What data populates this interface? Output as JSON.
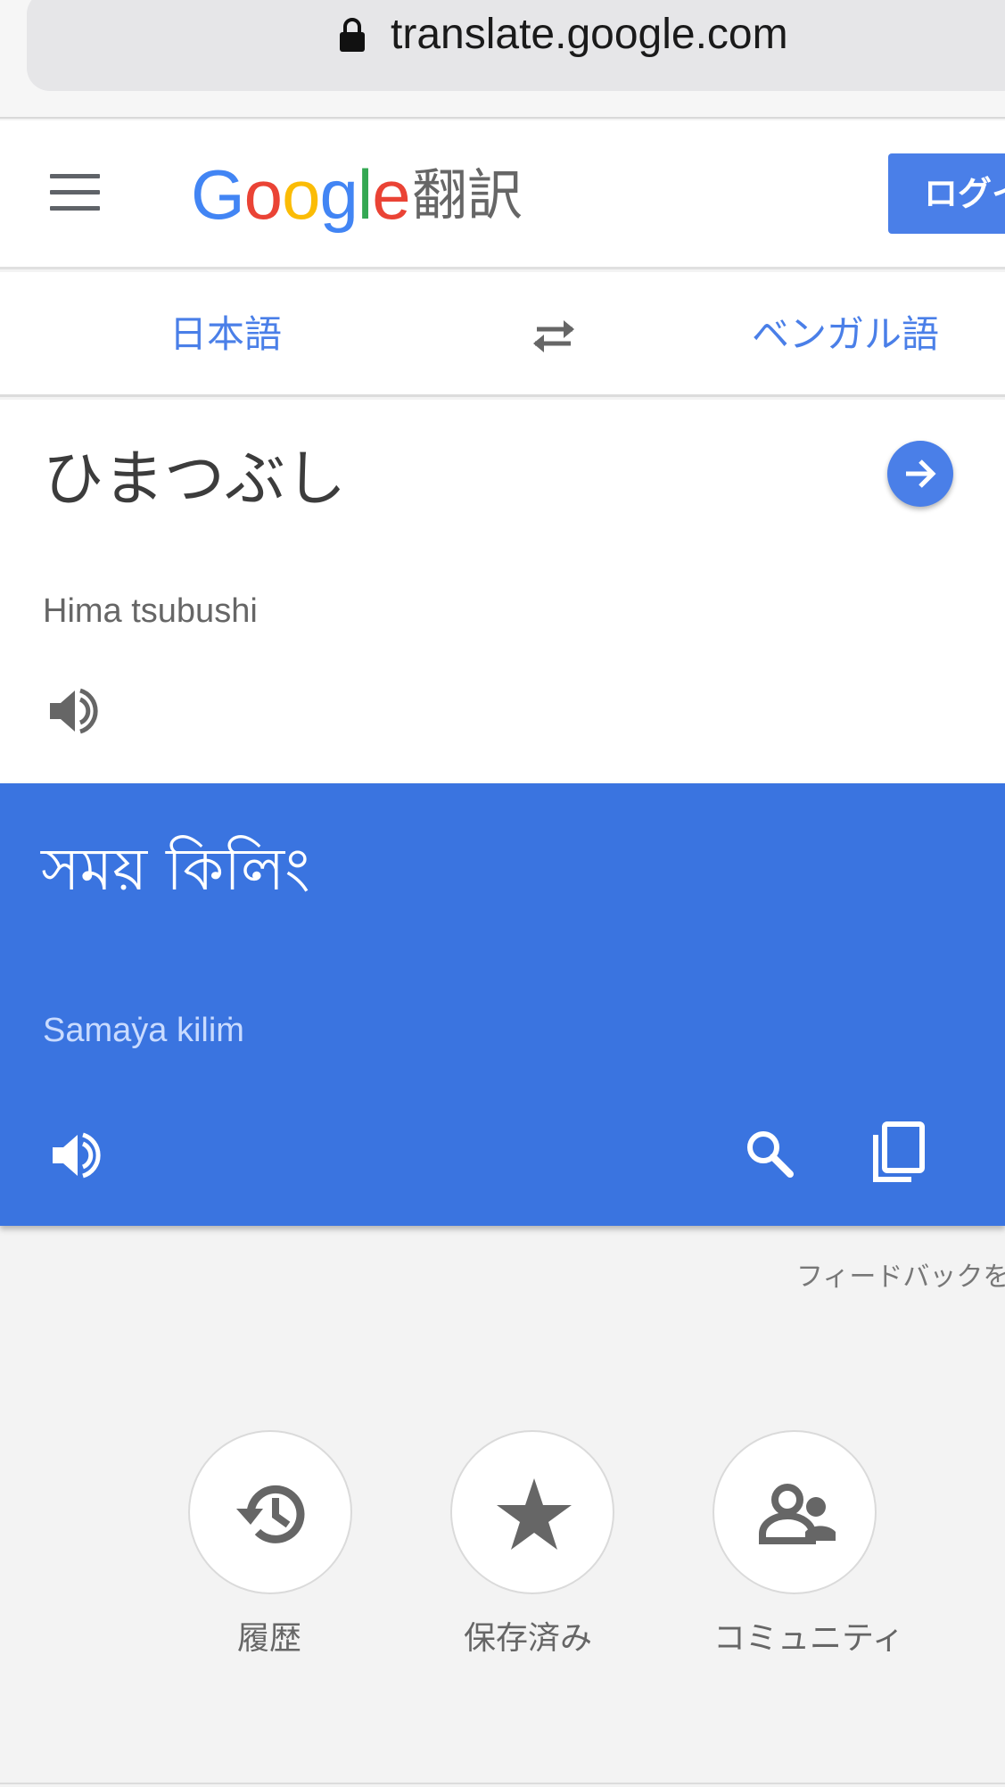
{
  "browser": {
    "url": "translate.google.com",
    "lock_icon": "lock-icon"
  },
  "header": {
    "menu_icon": "hamburger-menu-icon",
    "logo_letters": [
      "G",
      "o",
      "o",
      "g",
      "l",
      "e"
    ],
    "product_name": "翻訳",
    "login_label": "ログイ"
  },
  "languages": {
    "source": "日本語",
    "target": "ベンガル語",
    "swap_icon": "swap-arrows-icon"
  },
  "source": {
    "text": "ひまつぶし",
    "transliteration": "Hima tsubushi",
    "go_icon": "arrow-right-icon",
    "speaker_icon": "speaker-icon"
  },
  "result": {
    "text": "সময় কিলিং",
    "transliteration": "Samaẏa kiliṁ",
    "speaker_icon": "speaker-icon",
    "search_icon": "search-icon",
    "copy_icon": "copy-icon"
  },
  "feedback": "フィードバックを",
  "actions": [
    {
      "label": "履歴",
      "icon": "history-icon"
    },
    {
      "label": "保存済み",
      "icon": "star-icon"
    },
    {
      "label": "コミュニティ",
      "icon": "community-icon"
    }
  ],
  "colors": {
    "accent": "#4a7fe8",
    "result_bg": "#3a74e0",
    "logo_blue": "#4285f4",
    "logo_red": "#ea4335",
    "logo_yellow": "#fbbc05",
    "logo_green": "#34a853"
  }
}
